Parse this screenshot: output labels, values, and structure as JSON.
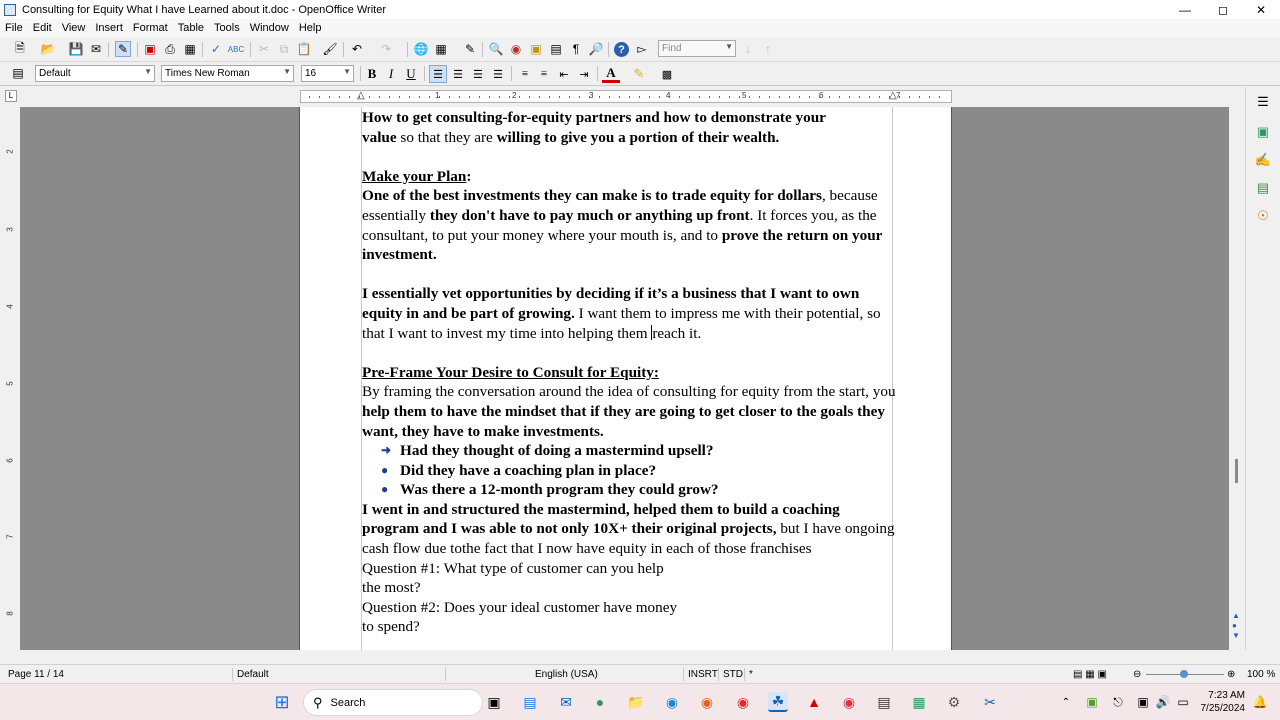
{
  "window": {
    "title": "Consulting for Equity What I have Learned about it.doc - OpenOffice Writer"
  },
  "menu": [
    "File",
    "Edit",
    "View",
    "Insert",
    "Format",
    "Table",
    "Tools",
    "Window",
    "Help"
  ],
  "toolbar": {
    "find_placeholder": "Find",
    "style": "Default",
    "font": "Times New Roman",
    "size": "16",
    "bold": "B",
    "italic": "I",
    "underline": "U"
  },
  "ruler": {
    "marks": [
      "1",
      "2",
      "3",
      "4",
      "5",
      "6",
      "7"
    ],
    "vmarks": [
      "2",
      "3",
      "4",
      "5",
      "6",
      "7",
      "8"
    ],
    "tab_glyph": "L"
  },
  "document": {
    "line0": "How to get consulting-for-equity partners and how to demonstrate your",
    "line1_a": "value",
    "line1_b": " so that they are ",
    "line1_c": "willing to give you a portion of their wealth.",
    "h1": "Make your Plan",
    "h1_colon": ":",
    "p1_a": "One of the best investments they can make is to trade equity for dollars",
    "p1_b": ", because essentially ",
    "p1_c": "they don't have to pay much or anything up front",
    "p1_d": ". It forces you, as the consultant, to put your money where your mouth is, and to ",
    "p1_e": "prove the return on your investment.",
    "p2_a": "I essentially vet opportunities by deciding if it’s a business that I want to own equity in and be part of growing.",
    "p2_b": " I want them to impress me with their potential, so that I want to invest my time into helping them ",
    "p2_c": "reach it.",
    "h2": "Pre-Frame Your Desire to Consult for Equity:",
    "p3_a": "By framing the conversation around the idea of consulting for equity from the start, you ",
    "p3_b": "help them to have the mindset that if they are going to get closer to the goals they want, they have to make investments.",
    "bullets": [
      "Had they thought of doing a mastermind upsell?",
      "Did they have a coaching plan in place?",
      "Was there a 12-month program they could grow?"
    ],
    "p4_a": "I went in and structured the mastermind, helped them to build a coaching program and I was able to not only 10X+ their original projects,",
    "p4_b": " but I have ongoing cash flow due tothe fact that I now have equity in each of those franchises",
    "q1a": "Question #1: What type of customer can you help",
    "q1b": "the most?",
    "q2a": "Question #2: Does your ideal customer have money",
    "q2b": "to spend?"
  },
  "status": {
    "page": "Page 11 / 14",
    "style": "Default",
    "language": "English (USA)",
    "insert": "INSRT",
    "sel": "STD",
    "modified": "*",
    "zoom": "100 %"
  },
  "taskbar": {
    "search": "Search",
    "time": "7:23 AM",
    "date": "7/25/2024"
  },
  "colors": {
    "accent": "#1a3d8f",
    "taskbar": "#f3e7e9",
    "workspace": "#8a8a8a"
  }
}
